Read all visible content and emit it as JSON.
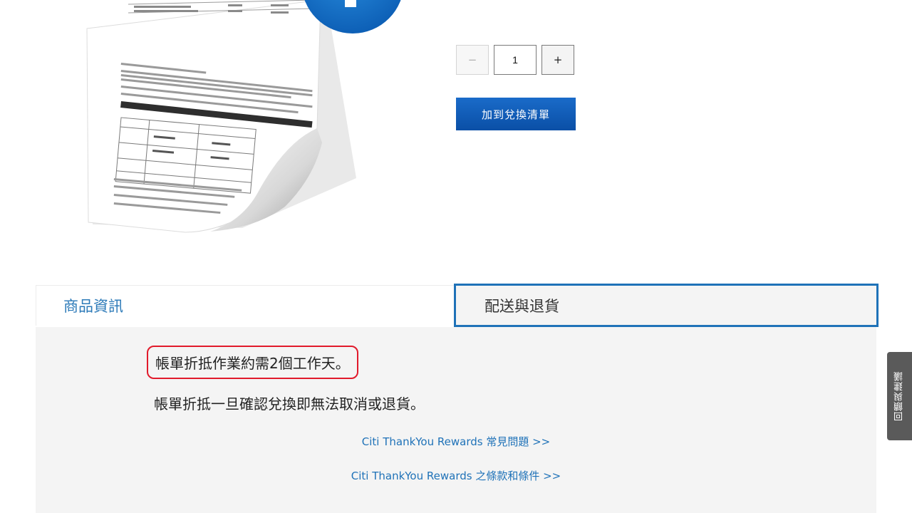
{
  "product": {
    "image_alt": "帳單折抵"
  },
  "quantity": {
    "value": "1",
    "minus_label": "−",
    "plus_label": "+"
  },
  "add_button": {
    "label": "加到兌換清單"
  },
  "tabs": [
    {
      "label": "商品資訊",
      "active": false
    },
    {
      "label": "配送與退貨",
      "active": true
    }
  ],
  "content": {
    "line1": "帳單折抵作業約需2個工作天。",
    "line2": "帳單折抵一旦確認兌換即無法取消或退貨。",
    "links": [
      {
        "label": "Citi ThankYou Rewards 常見問題 >>"
      },
      {
        "label": "Citi ThankYou Rewards 之條款和條件 >>"
      }
    ]
  },
  "feedback": {
    "label": "回饋與建議"
  },
  "colors": {
    "accent": "#1f72b8",
    "button": "#0a4fa6",
    "highlight": "#e11a2b",
    "panel_bg": "#f4f4f4"
  }
}
